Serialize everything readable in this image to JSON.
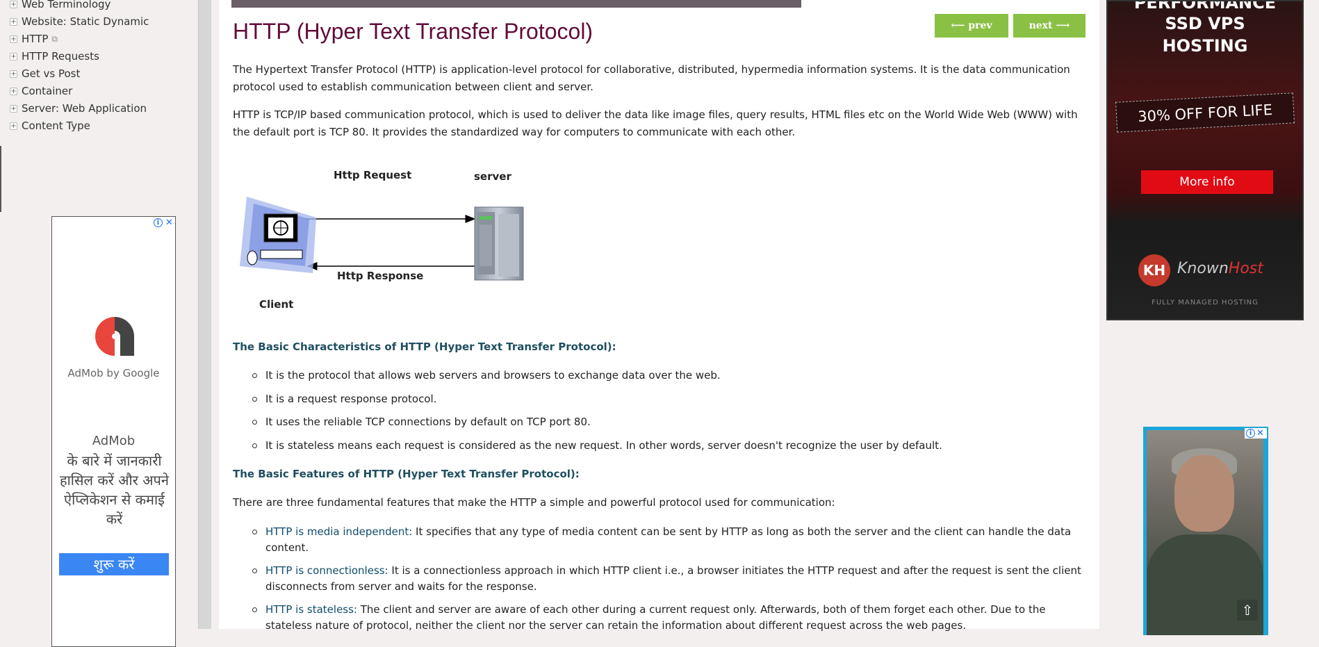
{
  "sidebar": {
    "items": [
      {
        "label": "Web Terminology",
        "icon": "expand-icon"
      },
      {
        "label": "Website: Static Dynamic",
        "icon": "expand-icon"
      },
      {
        "label": "HTTP",
        "icon": "expand-icon",
        "external": true
      },
      {
        "label": "HTTP Requests",
        "icon": "expand-icon"
      },
      {
        "label": "Get vs Post",
        "icon": "expand-icon"
      },
      {
        "label": "Container",
        "icon": "expand-icon"
      },
      {
        "label": "Server: Web Application",
        "icon": "expand-icon"
      },
      {
        "label": "Content Type",
        "icon": "expand-icon"
      }
    ],
    "bullet_glyph": "+"
  },
  "ad_left": {
    "brand": "AdMob by Google",
    "title": "AdMob",
    "body": "के बारे में जानकारी हासिल करें और अपने ऐप्लिकेशन से कमाई करें",
    "cta": "शुरू करें",
    "info_glyph": "i",
    "close_glyph": "✕"
  },
  "page": {
    "title": "HTTP (Hyper Text Transfer Protocol)",
    "prev": "⟵ prev",
    "next": "next ⟶",
    "p1": "The Hypertext Transfer Protocol (HTTP) is application-level protocol for collaborative, distributed, hypermedia information systems. It is the data communication protocol used to establish communication between client and server.",
    "p2": "HTTP is TCP/IP based communication protocol, which is used to deliver the data like image files, query results, HTML files etc on the World Wide Web (WWW) with the default port is TCP 80. It provides the standardized way for computers to communicate with each other.",
    "diagram": {
      "request_label": "Http Request",
      "response_label": "Http Response",
      "server_label": "server",
      "client_label": "Client"
    },
    "characteristics_heading": "The Basic Characteristics of HTTP (Hyper Text Transfer Protocol):",
    "characteristics": [
      "It is the protocol that allows web servers and browsers to exchange data over the web.",
      "It is a request response protocol.",
      "It uses the reliable TCP connections by default on TCP port 80.",
      "It is stateless means each request is considered as the new request. In other words, server doesn't recognize the user by default."
    ],
    "features_heading": "The Basic Features of HTTP (Hyper Text Transfer Protocol):",
    "features_intro": "There are three fundamental features that make the HTTP a simple and powerful protocol used for communication:",
    "features": [
      {
        "term": "HTTP is media independent:",
        "text": " It specifies that any type of media content can be sent by HTTP as long as both the server and the client can handle the data content."
      },
      {
        "term": "HTTP is connectionless:",
        "text": " It is a connectionless approach in which HTTP client i.e., a browser initiates the HTTP request and after the request is sent the client disconnects from server and waits for the response."
      },
      {
        "term": "HTTP is stateless:",
        "text": " The client and server are aware of each other during a current request only. Afterwards, both of them forget each other. Due to the stateless nature of protocol, neither the client nor the server can retain the information about different request across the web pages."
      }
    ]
  },
  "ad_right_top": {
    "line1": "PERFORMANCE",
    "line2": "SSD VPS",
    "line3": "HOSTING",
    "offer": "30% OFF FOR LIFE",
    "cta": "More info",
    "logo_glyph": "KH",
    "brand_a": "Known",
    "brand_b": "Host",
    "tagline": "FULLY MANAGED HOSTING",
    "accent_color": "#e10b14"
  },
  "ad_right_bottom": {
    "info_glyph": "i",
    "close_glyph": "✕"
  },
  "scroll_top_glyph": "⇧"
}
